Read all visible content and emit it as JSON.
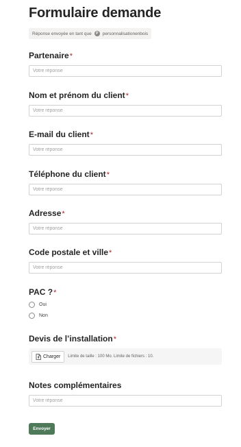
{
  "form": {
    "title": "Formulaire demande",
    "sent_as_text": "Réponse envoyée en tant que",
    "account_initial": "P",
    "account_name": "personnalisationenbois",
    "required_marker": "*"
  },
  "questions": [
    {
      "label": "Partenaire",
      "placeholder": "Votre réponse",
      "required": true
    },
    {
      "label": "Nom et prénom du client",
      "placeholder": "Votre réponse",
      "required": true
    },
    {
      "label": "E-mail du client",
      "placeholder": "Votre réponse",
      "required": true
    },
    {
      "label": "Téléphone du client",
      "placeholder": "Votre réponse",
      "required": true
    },
    {
      "label": "Adresse",
      "placeholder": "Votre réponse",
      "required": true
    },
    {
      "label": "Code postale et ville",
      "placeholder": "Votre réponse",
      "required": true
    }
  ],
  "pac": {
    "label": "PAC ?",
    "required": true,
    "options": [
      "Oui",
      "Non"
    ]
  },
  "devis": {
    "label": "Devis de l’installation",
    "required": true,
    "upload_label": "Charger",
    "limits_text": "Limite de taille : 100 Mo. Limite de fichiers : 10."
  },
  "notes": {
    "label": "Notes complémentaires",
    "placeholder": "Votre réponse",
    "required": false
  },
  "submit_label": "Envoyer",
  "colors": {
    "submit": "#4e7a5a",
    "required": "#a4262c"
  }
}
